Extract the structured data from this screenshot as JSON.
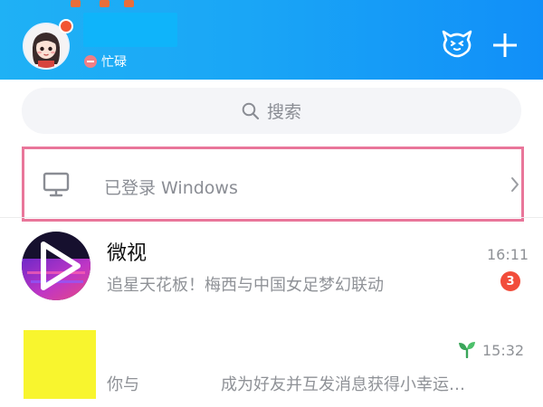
{
  "colors": {
    "header_gradient_start": "#1fb1f5",
    "header_gradient_end": "#118ff8",
    "unread_badge": "#f24d3b",
    "highlight_border": "#e9769a",
    "placeholder_block": "#f8f52e"
  },
  "header": {
    "status_label": "忙碌",
    "icons": [
      "avatar-icon",
      "pet-icon",
      "plus-icon"
    ]
  },
  "search": {
    "placeholder": "搜索"
  },
  "login_notice": {
    "label": "已登录 Windows",
    "icon": "monitor-icon"
  },
  "chats": [
    {
      "name": "微视",
      "time": "16:11",
      "preview": "追星天花板！梅西与中国女足梦幻联动",
      "unread": "3"
    },
    {
      "name": "",
      "time": "15:32",
      "preview_prefix": "你与",
      "preview_suffix": "成为好友并互发消息获得小幸运…",
      "time_icon": "sprout-icon"
    }
  ]
}
